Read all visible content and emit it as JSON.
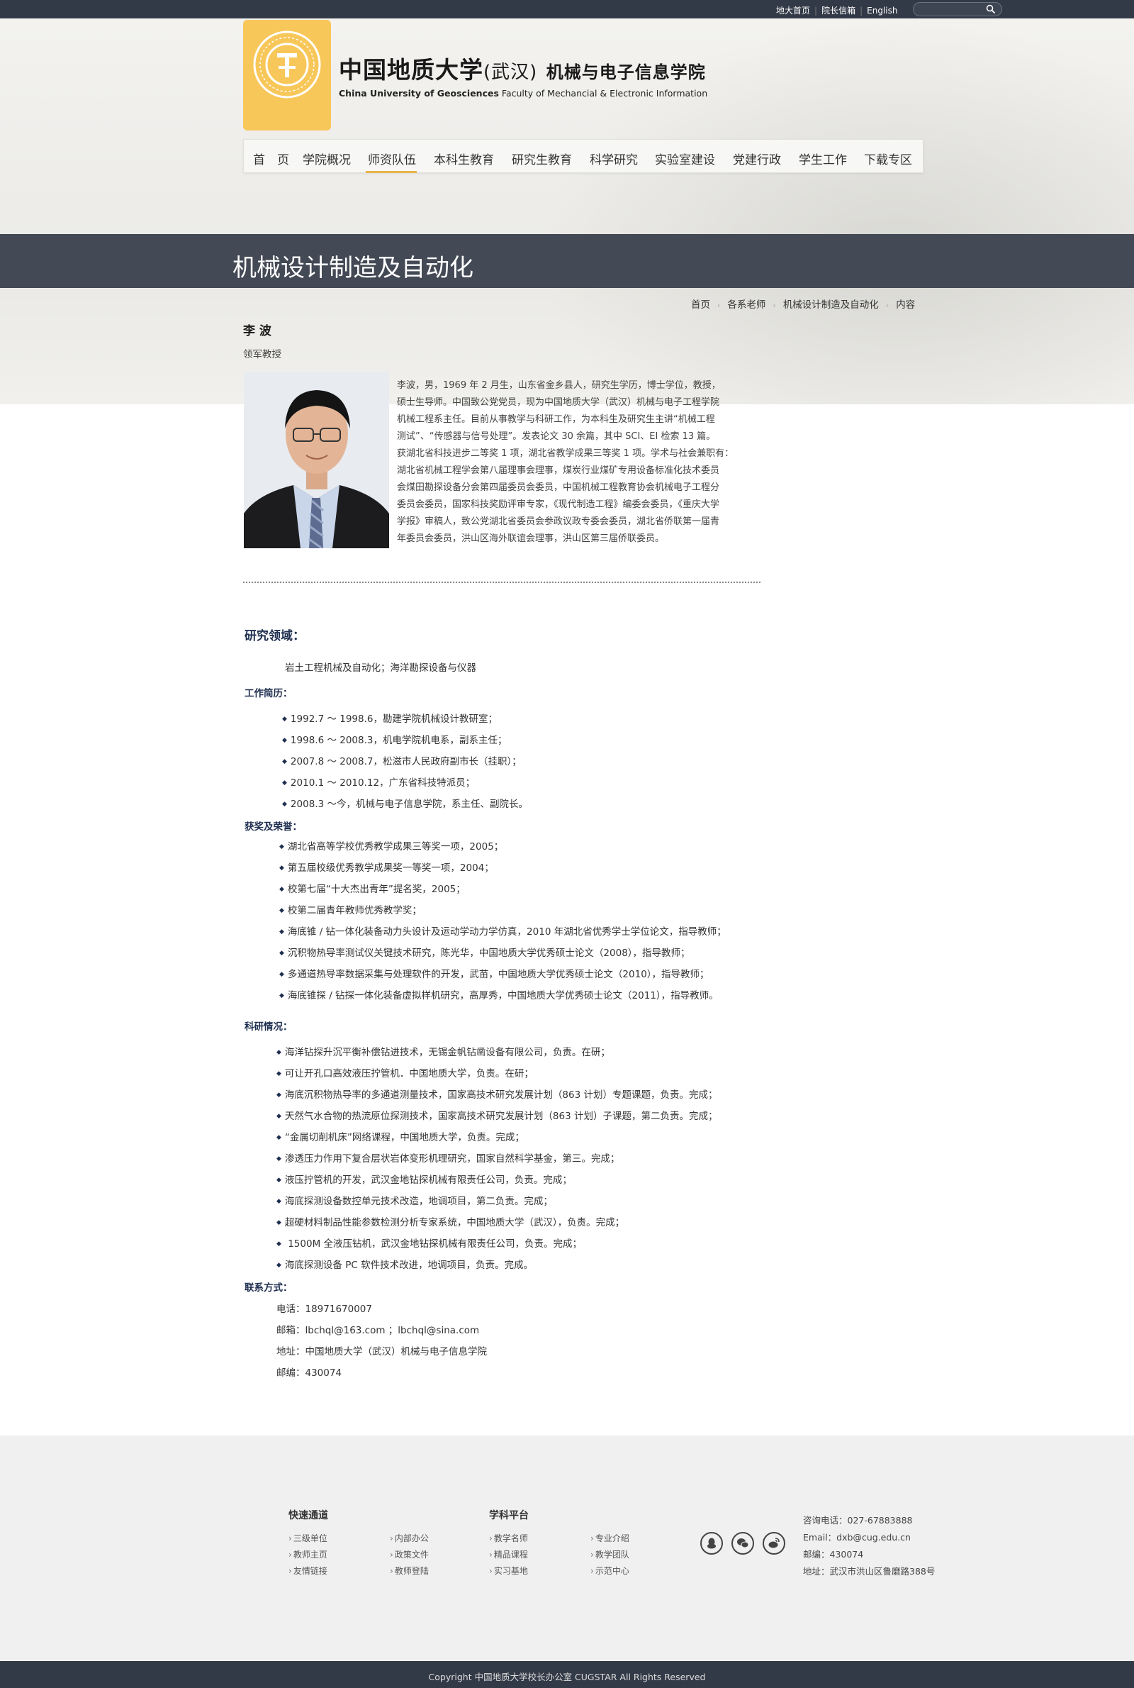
{
  "topbar": {
    "links": [
      "地大首页",
      "院长信箱",
      "English"
    ],
    "search_placeholder": ""
  },
  "brand": {
    "cn_main": "中国地质大学",
    "cn_sub": "(武汉)",
    "cn_faculty": "机械与电子信息学院",
    "en_bold": "China University of Geosciences",
    "en_rest": " Faculty of Mechancial & Electronic Information"
  },
  "nav": {
    "items": [
      "首　页",
      "学院概况",
      "师资队伍",
      "本科生教育",
      "研究生教育",
      "科学研究",
      "实验室建设",
      "党建行政",
      "学生工作",
      "下载专区"
    ],
    "active": "师资队伍"
  },
  "page_title": "机械设计制造及自动化",
  "breadcrumb": [
    "首页",
    "各系老师",
    "机械设计制造及自动化",
    "内容"
  ],
  "person": {
    "name": "李 波",
    "title": "领军教授",
    "bio_lines": [
      "李波，男，1969 年 2 月生，山东省金乡县人，研究生学历，博士学位，教授，",
      "硕士生导师。中国致公党党员，现为中国地质大学（武汉）机械与电子工程学院",
      "机械工程系主任。目前从事教学与科研工作，为本科生及研究生主讲“机械工程",
      "测试”、“传感器与信号处理”。发表论文 30 余篇，其中 SCI、EI 检索 13 篇。",
      "获湖北省科技进步二等奖 1 项，湖北省教学成果三等奖 1 项。学术与社会兼职有：",
      "湖北省机械工程学会第八届理事会理事，煤炭行业煤矿专用设备标准化技术委员",
      "会煤田勘探设备分会第四届委员会委员，中国机械工程教育协会机械电子工程分",
      "委员会委员，国家科技奖励评审专家，《现代制造工程》编委会委员，《重庆大学",
      "学报》审稿人，致公党湖北省委员会参政议政专委会委员，湖北省侨联第一届青",
      "年委员会委员，洪山区海外联谊会理事，洪山区第三届侨联委员。"
    ]
  },
  "research": {
    "heading": "研究领域：",
    "text": "岩土工程机械及自动化；海洋勘探设备与仪器"
  },
  "work": {
    "heading": "工作简历：",
    "items": [
      "1992.7 ～ 1998.6，勘建学院机械设计教研室；",
      "1998.6 ～ 2008.3，机电学院机电系，副系主任；",
      "2007.8 ～ 2008.7，松滋市人民政府副市长（挂职）；",
      "2010.1 ～ 2010.12，广东省科技特派员；",
      "2008.3 ～今，机械与电子信息学院，系主任、副院长。"
    ]
  },
  "awards": {
    "heading": "获奖及荣誉：",
    "items": [
      "湖北省高等学校优秀教学成果三等奖一项，2005；",
      "第五届校级优秀教学成果奖一等奖一项，2004；",
      "校第七届“十大杰出青年”提名奖，2005；",
      "校第二届青年教师优秀教学奖；",
      "海底锥 / 钻一体化装备动力头设计及运动学动力学仿真，2010 年湖北省优秀学士学位论文，指导教师；",
      "沉积物热导率测试仪关键技术研究，陈光华，中国地质大学优秀硕士论文（2008），指导教师；",
      "多通道热导率数据采集与处理软件的开发，武苗，中国地质大学优秀硕士论文（2010），指导教师；",
      "海底锥探 / 钻探一体化装备虚拟样机研究，高厚秀，中国地质大学优秀硕士论文（2011），指导教师。"
    ]
  },
  "projects": {
    "heading": "科研情况：",
    "items": [
      "海洋钻探升沉平衡补偿钻进技术，无锡金帆钻凿设备有限公司，负责。在研；",
      "可让开孔口高效液压拧管机．中国地质大学，负责。在研；",
      "海底沉积物热导率的多通道测量技术，国家高技术研究发展计划（863 计划）专题课题，负责。完成；",
      "天然气水合物的热流原位探测技术，国家高技术研究发展计划（863 计划）子课题，第二负责。完成；",
      "“金属切削机床”网络课程，中国地质大学，负责。完成；",
      "渗透压力作用下复合层状岩体变形机理研究，国家自然科学基金，第三。完成；",
      "液压拧管机的开发，武汉金地钻探机械有限责任公司，负责。完成；",
      "海底探测设备数控单元技术改造，地调项目，第二负责。完成；",
      "超硬材料制品性能参数检测分析专家系统，中国地质大学（武汉），负责。完成；",
      " 1500M 全液压钻机，武汉金地钻探机械有限责任公司，负责。完成；",
      "海底探测设备 PC 软件技术改进，地调项目，负责。完成。"
    ]
  },
  "contact": {
    "heading": "联系方式：",
    "items": [
      "电话：18971670007",
      "邮箱：lbchql@163.com ；lbchql@sina.com",
      "地址：中国地质大学（武汉）机械与电子信息学院",
      "邮编：430074"
    ]
  },
  "footer": {
    "quick_heading": "快速通道",
    "quick_col1": [
      "三级单位",
      "教师主页",
      "友情链接"
    ],
    "quick_col2": [
      "内部办公",
      "政策文件",
      "教师登陆"
    ],
    "platform_heading": "学科平台",
    "platform_col1": [
      "教学名师",
      "精品课程",
      "实习基地"
    ],
    "platform_col2": [
      "专业介绍",
      "教学团队",
      "示范中心"
    ],
    "social_icons": [
      "qq-icon",
      "wechat-icon",
      "weibo-icon"
    ],
    "contact_lines": [
      "咨询电话：027-67883888",
      "Email：dxb@cug.edu.cn",
      "邮编：430074",
      "地址：武汉市洪山区鲁磨路388号"
    ],
    "copyright": "Copyright 中国地质大学校长办公室 CUGSTAR All Rights Reserved"
  },
  "colors": {
    "topbar": "#333a47",
    "accent": "#f8c75a",
    "heading": "#1e2e4f",
    "banner": "#434955"
  }
}
